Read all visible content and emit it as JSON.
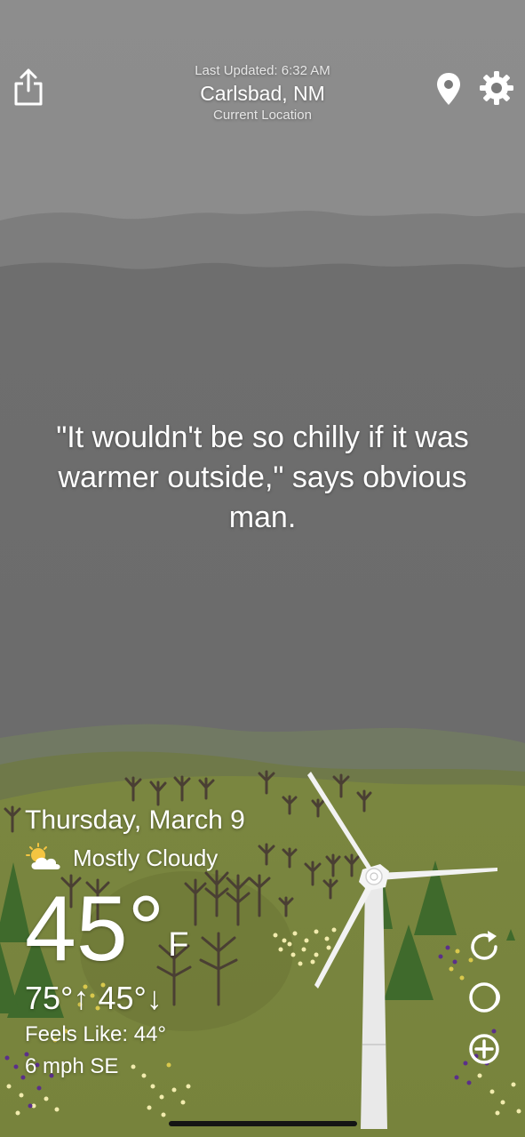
{
  "header": {
    "last_updated": "Last Updated: 6:32 AM",
    "city": "Carlsbad, NM",
    "location_subtitle": "Current Location"
  },
  "icons": {
    "share": "share-icon",
    "location": "location-pin-icon",
    "settings": "gear-icon",
    "condition": "partly-cloudy-icon",
    "refresh": "refresh-icon",
    "moon": "moon-phase-icon",
    "add": "add-circle-icon"
  },
  "quote": "\"It wouldn't be so chilly if it was warmer outside,\" says obvious man.",
  "weather": {
    "date": "Thursday, March 9",
    "condition": "Mostly Cloudy",
    "temperature": "45°",
    "unit": "F",
    "high_low": "75°↑ 45°↓",
    "feels_like": "Feels Like: 44°",
    "wind": "6 mph SE"
  },
  "colors": {
    "sky_top": "#8a8a8a",
    "sky_bottom": "#6b6b6b",
    "hills": "#6c7550",
    "grass": "#7e8c43",
    "tree_green": "#3f6a2c"
  }
}
